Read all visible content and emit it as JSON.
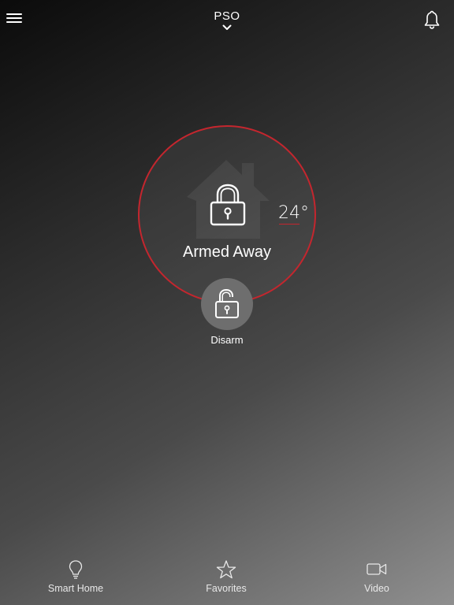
{
  "header": {
    "title": "PSO",
    "menu_icon": "hamburger-menu-icon",
    "dropdown_icon": "chevron-down-icon",
    "notification_icon": "bell-icon"
  },
  "status": {
    "label": "Armed Away",
    "temperature": "24°",
    "state_icon": "lock-closed-icon",
    "background_icon": "house-icon",
    "ring_color": "#c4262e"
  },
  "action": {
    "label": "Disarm",
    "icon": "lock-open-icon"
  },
  "bottom_nav": {
    "items": [
      {
        "label": "Smart Home",
        "icon": "lightbulb-icon"
      },
      {
        "label": "Favorites",
        "icon": "star-icon"
      },
      {
        "label": "Video",
        "icon": "video-camera-icon"
      }
    ]
  }
}
